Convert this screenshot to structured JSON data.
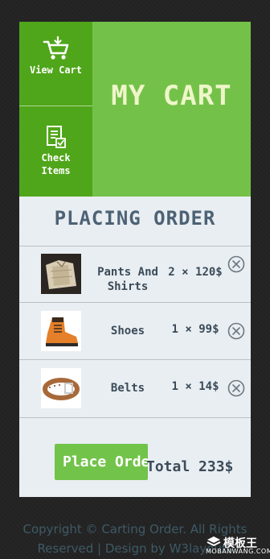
{
  "nav": {
    "view_cart": "View Cart",
    "check_items": "Check Items"
  },
  "header": {
    "title": "MY CART"
  },
  "section": {
    "title": "PLACING ORDER"
  },
  "items": [
    {
      "name": "Pants And Shirts",
      "quantity": "2",
      "times": "×",
      "price": "120$"
    },
    {
      "name": "Shoes",
      "quantity": "1",
      "times": "×",
      "price": "99$"
    },
    {
      "name": "Belts",
      "quantity": "1",
      "times": "×",
      "price": "14$"
    }
  ],
  "actions": {
    "place_order": "Place Order"
  },
  "summary": {
    "total": "Total 233$"
  },
  "footer": {
    "line1": "Copyright © Carting Order. All Rights",
    "line2": "Reserved | Design by W3layouts"
  },
  "watermark": {
    "line1": "模板王",
    "line2": "MOBANWANG.COM"
  },
  "colors": {
    "accent_green": "#74c14a",
    "nav_green": "#50a61a",
    "title_pale": "#eef6c9",
    "text_slate": "#3b4b59",
    "card_bg": "#e9eef2",
    "page_bg": "#232323"
  }
}
